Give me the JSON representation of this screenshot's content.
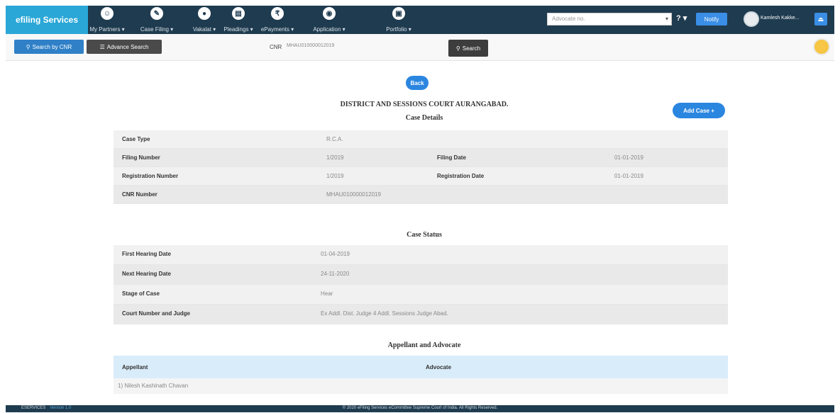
{
  "brand": {
    "title": "efiling Services"
  },
  "nav": {
    "items": [
      {
        "icon": "account-circle-icon",
        "label": "My Partners ▾"
      },
      {
        "icon": "edit-icon",
        "label": "Case Filing ▾"
      },
      {
        "icon": "gavel-icon",
        "label": "Vakalat ▾"
      },
      {
        "icon": "document-icon",
        "label": "Pleadings ▾"
      },
      {
        "icon": "payment-icon",
        "label": "ePayments ▾"
      },
      {
        "icon": "application-icon",
        "label": "Application ▾"
      },
      {
        "icon": "portfolio-icon",
        "label": "Portfolio ▾"
      }
    ],
    "search_placeholder": "Advocate no.",
    "help": "? ▾",
    "notify_label": "Notify",
    "username": "Kamlesh Kakke...",
    "logout_glyph": "⏏"
  },
  "toolbar": {
    "search_by_cnr": "Search by CNR",
    "advance_search": "Advance Search",
    "cnr_label": "CNR",
    "cnr_value": "MHAU010000012019",
    "search_button": "Search"
  },
  "case": {
    "back": "Back",
    "court": "DISTRICT AND SESSIONS COURT AURANGABAD.",
    "add_case": "Add Case +",
    "details_title": "Case Details",
    "details": {
      "case_type_label": "Case Type",
      "case_type_value": "R.C.A.",
      "filing_number_label": "Filing Number",
      "filing_number_value": "1/2019",
      "filing_date_label": "Filing Date",
      "filing_date_value": "01-01-2019",
      "registration_number_label": "Registration Number",
      "registration_number_value": "1/2019",
      "registration_date_label": "Registration Date",
      "registration_date_value": "01-01-2019",
      "cnr_number_label": "CNR Number",
      "cnr_number_value": "MHAU010000012019"
    },
    "status_title": "Case Status",
    "status": {
      "first_hearing_label": "First Hearing Date",
      "first_hearing_value": "01-04-2019",
      "next_hearing_label": "Next Hearing Date",
      "next_hearing_value": "24-11-2020",
      "stage_label": "Stage of Case",
      "stage_value": "Hear",
      "court_label": "Court Number and Judge",
      "court_value": "Ex Addl. Dist. Judge 4 Addl. Sessions Judge Abad."
    },
    "party_title": "Appellant and Advocate",
    "party_headers": {
      "appellant": "Appellant",
      "advocate": "Advocate"
    },
    "party_rows": [
      {
        "appellant": "1) Nilesh Kashinath Chavan",
        "advocate": ""
      }
    ]
  },
  "footer": {
    "left": "ESERVICES",
    "version": "Version 1.0",
    "center": "© 2020 eFiling Services eCommittee Supreme Court of India. All Rights Reserved."
  }
}
